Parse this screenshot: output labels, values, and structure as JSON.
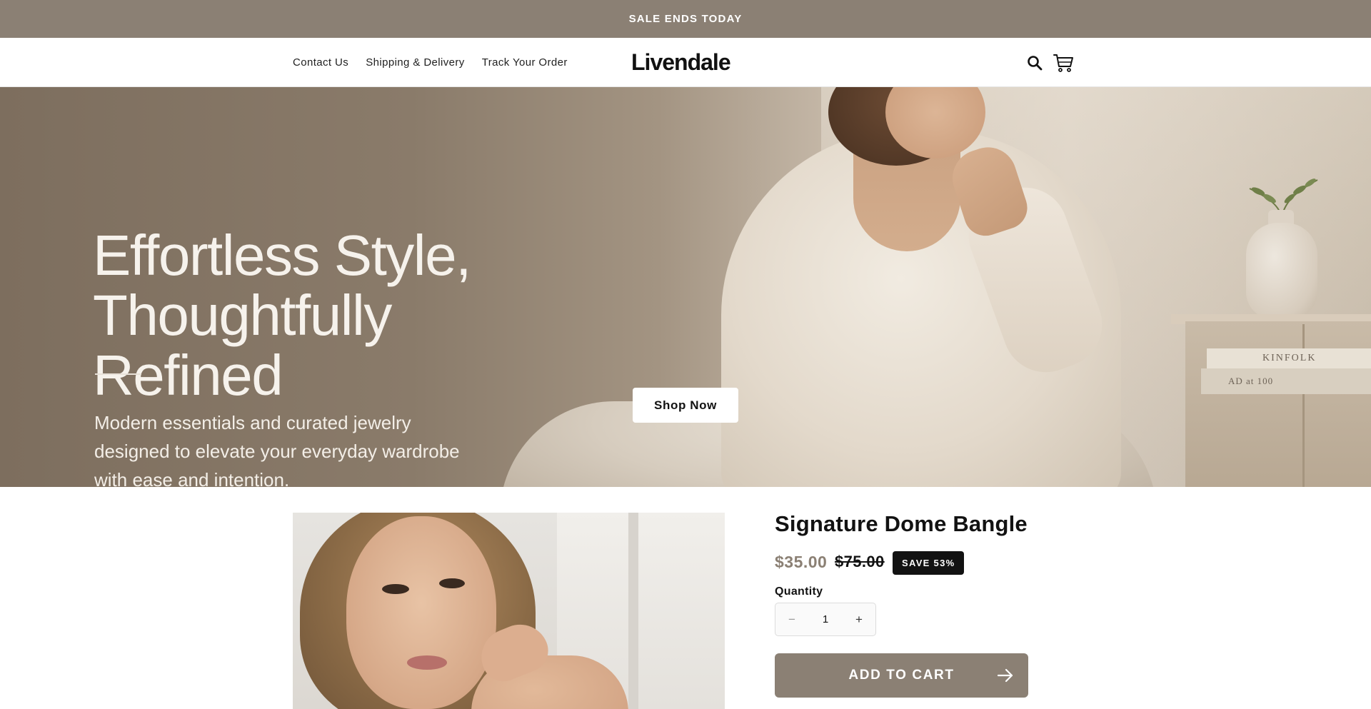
{
  "announcement": {
    "text": "SALE ENDS TODAY"
  },
  "header": {
    "nav": [
      {
        "label": "Contact Us"
      },
      {
        "label": "Shipping & Delivery"
      },
      {
        "label": "Track Your Order"
      }
    ],
    "logo": "Livendale",
    "icons": {
      "search": "search-icon",
      "cart": "cart-icon"
    }
  },
  "hero": {
    "title_line1": "Effortless Style,",
    "title_line2": "Thoughtfully Refined",
    "subtitle_line1": "Modern essentials and curated jewelry",
    "subtitle_line2": "designed to elevate your everyday wardrobe",
    "subtitle_line3": "with ease and intention.",
    "cta_label": "Shop Now",
    "book_text_1": "KINFOLK",
    "book_text_2": "AD at 100"
  },
  "product": {
    "title": "Signature Dome Bangle",
    "price": "$35.00",
    "compare_price": "$75.00",
    "badge": "SAVE 53%",
    "quantity_label": "Quantity",
    "quantity_value": "1",
    "minus_symbol": "−",
    "plus_symbol": "+",
    "add_to_cart_label": "ADD TO CART"
  },
  "colors": {
    "brand": "#8b8074",
    "text": "#121212",
    "badge_bg": "#121212",
    "background": "#ffffff"
  }
}
